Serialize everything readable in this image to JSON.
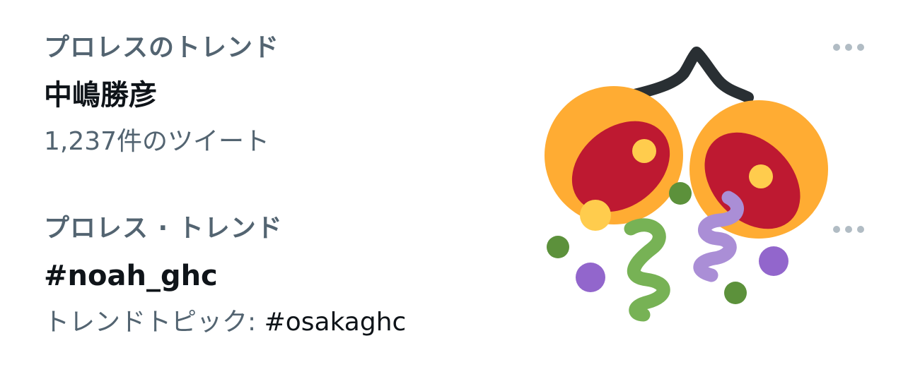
{
  "trends": [
    {
      "context": "プロレスのトレンド",
      "title": "中嶋勝彦",
      "meta": "1,237件のツイート"
    },
    {
      "context": "プロレス · トレンド",
      "title": "#noah_ghc",
      "meta_label": "トレンドトピック: ",
      "meta_tag": "#osakaghc"
    }
  ],
  "icons": {
    "more": "more-horizontal-icon",
    "emoji": "confetti-ball-emoji"
  },
  "colors": {
    "secondary_text": "#536471",
    "primary_text": "#0f1419",
    "more_dots": "#b1bcc4"
  }
}
